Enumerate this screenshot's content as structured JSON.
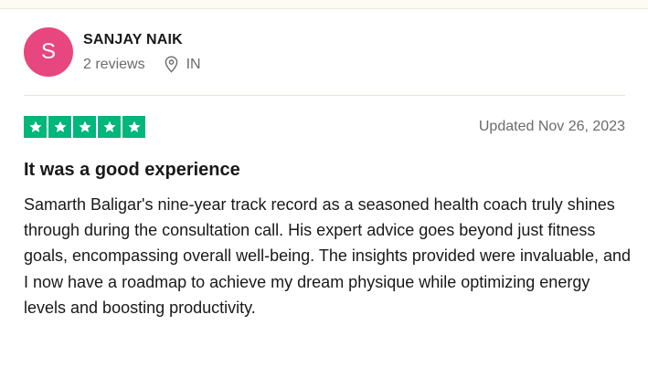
{
  "reviewer": {
    "initial": "S",
    "name": "SANJAY NAIK",
    "reviews_count": "2 reviews",
    "country": "IN",
    "avatar_color": "#e8467e"
  },
  "review": {
    "rating": 5,
    "max_rating": 5,
    "star_color": "#00b67a",
    "date": "Updated Nov 26, 2023",
    "title": "It was a good experience",
    "body": "Samarth Baligar's nine-year track record as a seasoned health coach truly shines through during the consultation call. His expert advice goes beyond just fitness goals, encompassing overall well-being. The insights provided were invaluable, and I now have a roadmap to achieve my dream physique while optimizing energy levels and boosting productivity."
  },
  "icons": {
    "location": "location-pin-icon",
    "star": "star-icon"
  }
}
